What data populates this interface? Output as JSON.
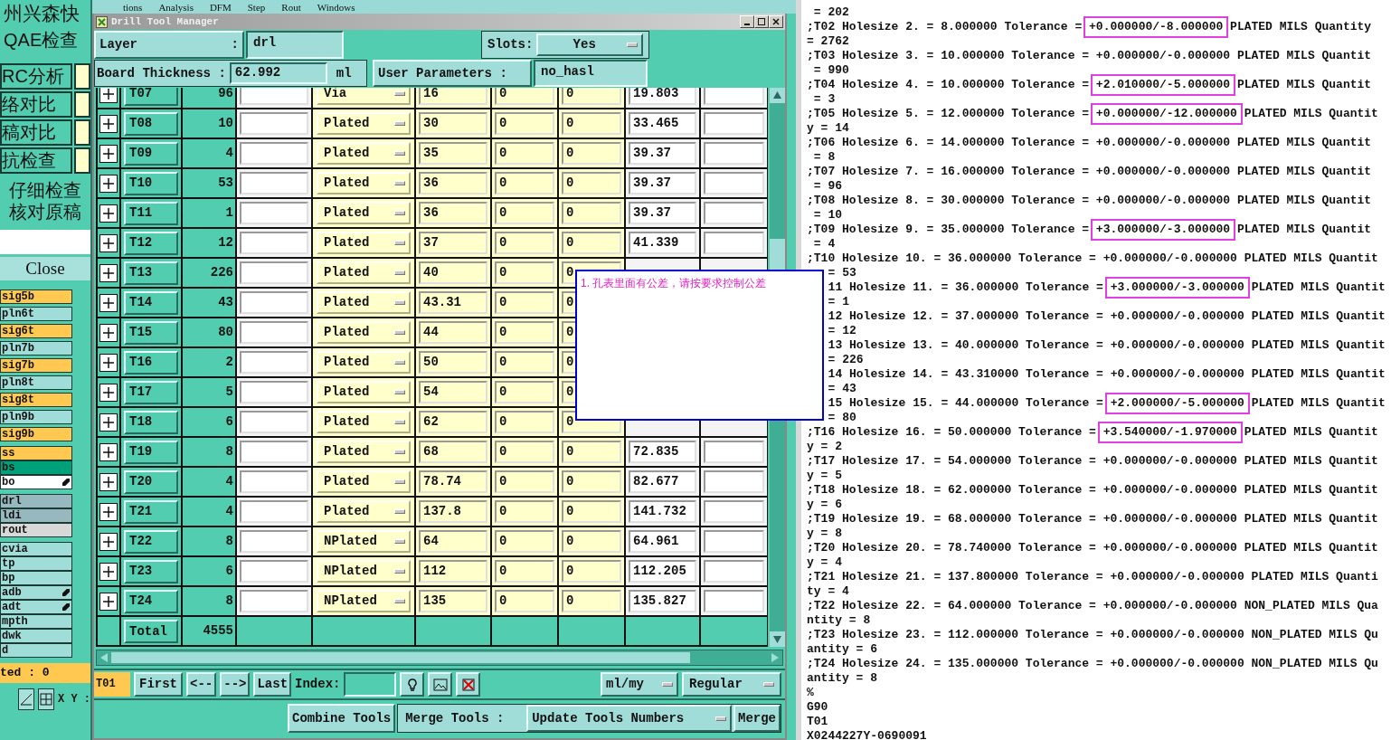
{
  "left_panel": {
    "company": "州兴森快",
    "title": "QAE检查",
    "tools": [
      "RC分析",
      "络对比",
      "稿对比",
      "抗检查"
    ],
    "notes": [
      "仔细检查",
      "核对原稿"
    ],
    "close": "Close",
    "layer_groups": [
      [
        {
          "name": "sig5b",
          "color": "#ffc850",
          "editable": false
        },
        {
          "name": "pln6t",
          "color": "#a0dcd8",
          "editable": false
        },
        {
          "name": "sig6t",
          "color": "#ffc850",
          "editable": false
        },
        {
          "name": "pln7b",
          "color": "#a0dcd8",
          "editable": false
        },
        {
          "name": "sig7b",
          "color": "#ffc850",
          "editable": false
        },
        {
          "name": "pln8t",
          "color": "#a0dcd8",
          "editable": false
        },
        {
          "name": "sig8t",
          "color": "#ffc850",
          "editable": false
        },
        {
          "name": "pln9b",
          "color": "#a0dcd8",
          "editable": false
        },
        {
          "name": "sig9b",
          "color": "#ffc850",
          "editable": false
        }
      ],
      [
        {
          "name": "ss",
          "color": "#ffc850",
          "editable": false
        },
        {
          "name": "bs",
          "color": "#00a07a",
          "editable": false
        },
        {
          "name": "bo",
          "color": "#ffffff",
          "editable": true
        }
      ],
      [
        {
          "name": "drl",
          "color": "#98b8c0",
          "editable": false
        },
        {
          "name": "ldi",
          "color": "#98b8c0",
          "editable": false
        },
        {
          "name": "rout",
          "color": "#d8d8d8",
          "editable": false
        }
      ],
      [
        {
          "name": "cvia",
          "color": "#a0dcd8",
          "editable": false
        },
        {
          "name": "tp",
          "color": "#a0dcd8",
          "editable": false
        },
        {
          "name": "bp",
          "color": "#a0dcd8",
          "editable": false
        },
        {
          "name": "adb",
          "color": "#a0dcd8",
          "editable": true
        },
        {
          "name": "adt",
          "color": "#a0dcd8",
          "editable": true
        },
        {
          "name": "mpth",
          "color": "#a0dcd8",
          "editable": false
        },
        {
          "name": "dwk",
          "color": "#a0dcd8",
          "editable": false
        },
        {
          "name": "d",
          "color": "#a0dcd8",
          "editable": false
        }
      ]
    ],
    "status": "ted : 0",
    "xy_label": "X Y :"
  },
  "menu": [
    "tions",
    "Analysis",
    "DFM",
    "Step",
    "Rout",
    "Windows"
  ],
  "window": {
    "title": "Drill Tool Manager",
    "layer": {
      "label": "Layer",
      "colon": ":",
      "value": "drl"
    },
    "slots": {
      "label": "Slots:",
      "value": "Yes"
    },
    "thickness": {
      "label": "Board Thickness :",
      "value": "62.992",
      "unit": "ml"
    },
    "user_parameters": {
      "label": "User Parameters :",
      "value": "no_hasl"
    },
    "rows": [
      {
        "tool": "T07",
        "count": "96",
        "type": "Via",
        "size": "16",
        "col_7": "0",
        "col_8": "0",
        "col_9": "19.803"
      },
      {
        "tool": "T08",
        "count": "10",
        "type": "Plated",
        "size": "30",
        "col_7": "0",
        "col_8": "0",
        "col_9": "33.465"
      },
      {
        "tool": "T09",
        "count": "4",
        "type": "Plated",
        "size": "35",
        "col_7": "0",
        "col_8": "0",
        "col_9": "39.37"
      },
      {
        "tool": "T10",
        "count": "53",
        "type": "Plated",
        "size": "36",
        "col_7": "0",
        "col_8": "0",
        "col_9": "39.37"
      },
      {
        "tool": "T11",
        "count": "1",
        "type": "Plated",
        "size": "36",
        "col_7": "0",
        "col_8": "0",
        "col_9": "39.37"
      },
      {
        "tool": "T12",
        "count": "12",
        "type": "Plated",
        "size": "37",
        "col_7": "0",
        "col_8": "0",
        "col_9": "41.339"
      },
      {
        "tool": "T13",
        "count": "226",
        "type": "Plated",
        "size": "40",
        "col_7": "0",
        "col_8": "0"
      },
      {
        "tool": "T14",
        "count": "43",
        "type": "Plated",
        "size": "43.31",
        "col_7": "0",
        "col_8": "0"
      },
      {
        "tool": "T15",
        "count": "80",
        "type": "Plated",
        "size": "44",
        "col_7": "0",
        "col_8": "0"
      },
      {
        "tool": "T16",
        "count": "2",
        "type": "Plated",
        "size": "50",
        "col_7": "0",
        "col_8": "0"
      },
      {
        "tool": "T17",
        "count": "5",
        "type": "Plated",
        "size": "54",
        "col_7": "0",
        "col_8": "0"
      },
      {
        "tool": "T18",
        "count": "6",
        "type": "Plated",
        "size": "62",
        "col_7": "0",
        "col_8": "0"
      },
      {
        "tool": "T19",
        "count": "8",
        "type": "Plated",
        "size": "68",
        "col_7": "0",
        "col_8": "0",
        "col_9": "72.835"
      },
      {
        "tool": "T20",
        "count": "4",
        "type": "Plated",
        "size": "78.74",
        "col_7": "0",
        "col_8": "0",
        "col_9": "82.677"
      },
      {
        "tool": "T21",
        "count": "4",
        "type": "Plated",
        "size": "137.8",
        "col_7": "0",
        "col_8": "0",
        "col_9": "141.732"
      },
      {
        "tool": "T22",
        "count": "8",
        "type": "NPlated",
        "size": "64",
        "col_7": "0",
        "col_8": "0",
        "col_9": "64.961"
      },
      {
        "tool": "T23",
        "count": "6",
        "type": "NPlated",
        "size": "112",
        "col_7": "0",
        "col_8": "0",
        "col_9": "112.205"
      },
      {
        "tool": "T24",
        "count": "8",
        "type": "NPlated",
        "size": "135",
        "col_7": "0",
        "col_8": "0",
        "col_9": "135.827"
      }
    ],
    "total": {
      "label": "Total",
      "value": "4555"
    },
    "nav": {
      "current": "T01",
      "buttons": [
        "First",
        "<--",
        "-->",
        "Last"
      ],
      "index_label": "Index:",
      "units": "ml/my",
      "mode": "Regular"
    },
    "actions": {
      "combine": "Combine Tools",
      "merge_label": "Merge Tools :",
      "merge_mode": "Update Tools Numbers",
      "merge": "Merge"
    }
  },
  "note": {
    "text": "1. 孔表里面有公差，请按要求控制公差"
  },
  "editor": {
    "lines": [
      {
        "text": " = 202"
      },
      {
        "before": ";T02 Holesize 2. = 8.000000 Tolerance = ",
        "tolerance": "+0.000000/-8.000000",
        "after": " PLATED MILS Quantity"
      },
      {
        "text": "= 2762"
      },
      {
        "text": ";T03 Holesize 3. = 10.000000 Tolerance = +0.000000/-0.000000 PLATED MILS Quantit"
      },
      {
        "text": " = 990"
      },
      {
        "before": ";T04 Holesize 4. = 10.000000 Tolerance = ",
        "tolerance": "+2.010000/-5.000000",
        "after": " PLATED MILS Quantit"
      },
      {
        "text": " = 3"
      },
      {
        "before": ";T05 Holesize 5. = 12.000000 Tolerance = ",
        "tolerance": "+0.000000/-12.000000",
        "after": " PLATED MILS Quantit"
      },
      {
        "text": "y = 14"
      },
      {
        "text": ";T06 Holesize 6. = 14.000000 Tolerance = +0.000000/-0.000000 PLATED MILS Quantit"
      },
      {
        "text": " = 8"
      },
      {
        "text": ";T07 Holesize 7. = 16.000000 Tolerance = +0.000000/-0.000000 PLATED MILS Quantit"
      },
      {
        "text": " = 96"
      },
      {
        "text": ";T08 Holesize 8. = 30.000000 Tolerance = +0.000000/-0.000000 PLATED MILS Quantit"
      },
      {
        "text": " = 10"
      },
      {
        "before": ";T09 Holesize 9. = 35.000000 Tolerance = ",
        "tolerance": "+3.000000/-3.000000",
        "after": " PLATED MILS Quantit"
      },
      {
        "text": " = 4"
      },
      {
        "text": ";T10 Holesize 10. = 36.000000 Tolerance = +0.000000/-0.000000 PLATED MILS Quantit"
      },
      {
        "text": "= 53",
        "covered": true
      },
      {
        "before": "11 Holesize 11. = 36.000000 Tolerance = ",
        "tolerance": "+3.000000/-3.000000",
        "after": " PLATED MILS Quantit",
        "covered": true
      },
      {
        "text": "= 1",
        "covered": true
      },
      {
        "text": "12 Holesize 12. = 37.000000 Tolerance = +0.000000/-0.000000 PLATED MILS Quantit",
        "covered": true
      },
      {
        "text": "= 12",
        "covered": true
      },
      {
        "text": "13 Holesize 13. = 40.000000 Tolerance = +0.000000/-0.000000 PLATED MILS Quantit",
        "covered": true
      },
      {
        "text": "= 226",
        "covered": true
      },
      {
        "text": "14 Holesize 14. = 43.310000 Tolerance = +0.000000/-0.000000 PLATED MILS Quantit",
        "covered": true
      },
      {
        "text": "= 43",
        "covered": true
      },
      {
        "before": "15 Holesize 15. = 44.000000 Tolerance = ",
        "tolerance": "+2.000000/-5.000000",
        "after": " PLATED MILS Quantit",
        "covered": true
      },
      {
        "text": "= 80",
        "covered": true
      },
      {
        "before": ";T16 Holesize 16. = 50.000000 Tolerance = ",
        "tolerance": "+3.540000/-1.970000",
        "after": " PLATED MILS Quantit"
      },
      {
        "text": "y = 2"
      },
      {
        "text": ";T17 Holesize 17. = 54.000000 Tolerance = +0.000000/-0.000000 PLATED MILS Quantit"
      },
      {
        "text": "y = 5"
      },
      {
        "text": ";T18 Holesize 18. = 62.000000 Tolerance = +0.000000/-0.000000 PLATED MILS Quantit"
      },
      {
        "text": "y = 6"
      },
      {
        "text": ";T19 Holesize 19. = 68.000000 Tolerance = +0.000000/-0.000000 PLATED MILS Quantit"
      },
      {
        "text": "y = 8"
      },
      {
        "text": ";T20 Holesize 20. = 78.740000 Tolerance = +0.000000/-0.000000 PLATED MILS Quantit"
      },
      {
        "text": "y = 4"
      },
      {
        "text": ";T21 Holesize 21. = 137.800000 Tolerance = +0.000000/-0.000000 PLATED MILS Quanti"
      },
      {
        "text": "ty = 4"
      },
      {
        "text": ";T22 Holesize 22. = 64.000000 Tolerance = +0.000000/-0.000000 NON_PLATED MILS Qua"
      },
      {
        "text": "ntity = 8"
      },
      {
        "text": ";T23 Holesize 23. = 112.000000 Tolerance = +0.000000/-0.000000 NON_PLATED MILS Qu"
      },
      {
        "text": "antity = 6"
      },
      {
        "text": ";T24 Holesize 24. = 135.000000 Tolerance = +0.000000/-0.000000 NON_PLATED MILS Qu"
      },
      {
        "text": "antity = 8"
      },
      {
        "text": "%"
      },
      {
        "text": "G90"
      },
      {
        "text": "T01"
      },
      {
        "text": "X0244227Y-0690091"
      }
    ]
  }
}
